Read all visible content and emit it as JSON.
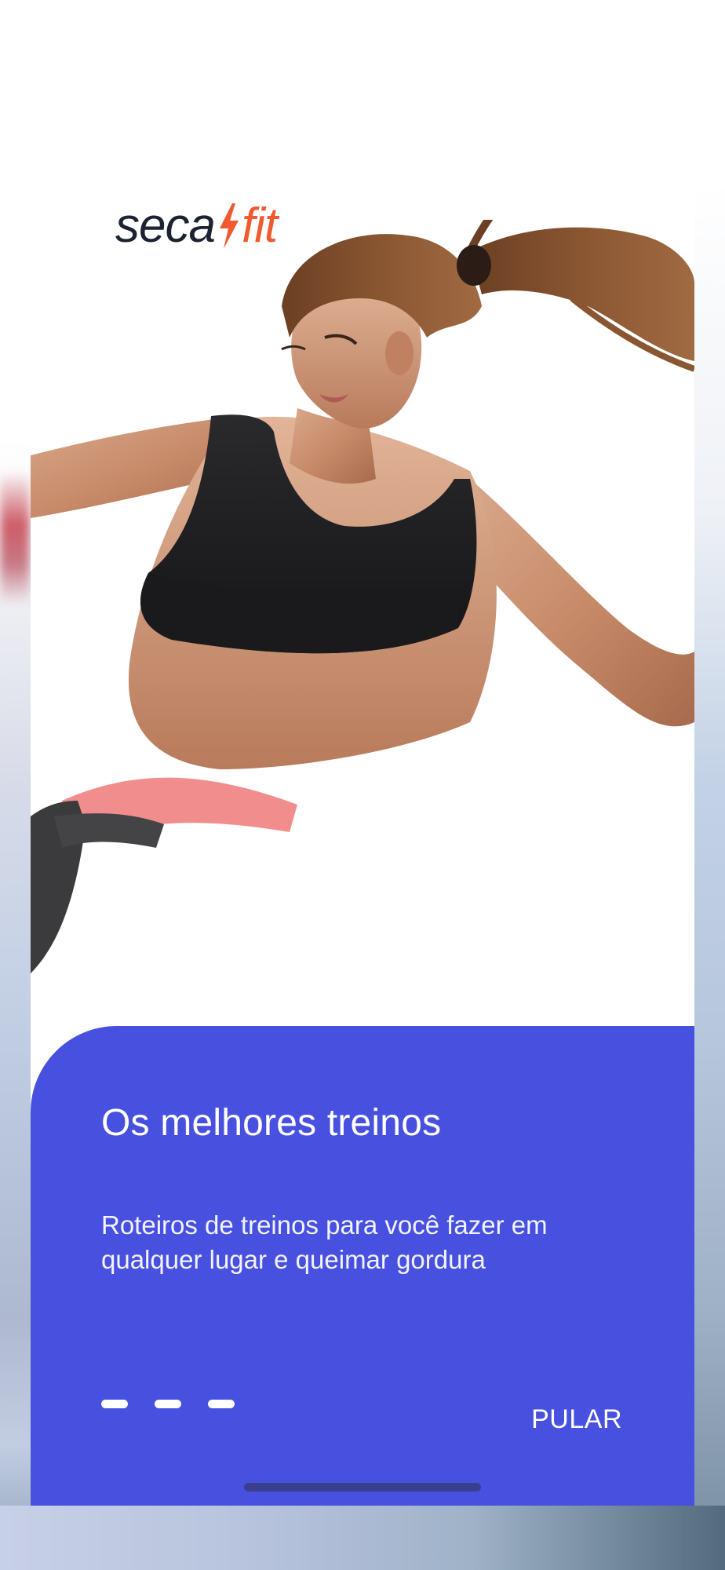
{
  "brand": {
    "name_part1": "seca",
    "name_part2": "fit",
    "colors": {
      "dark": "#1b2230",
      "accent": "#f05a2e"
    }
  },
  "hero": {
    "image": "woman-fitness-photo"
  },
  "onboarding": {
    "title": "Os melhores treinos",
    "subtitle": "Roteiros de treinos para você fazer em qualquer lugar e queimar gordura",
    "skip_label": "PULAR",
    "page_indicator": {
      "total": 3
    },
    "panel_color": "#4851df"
  }
}
